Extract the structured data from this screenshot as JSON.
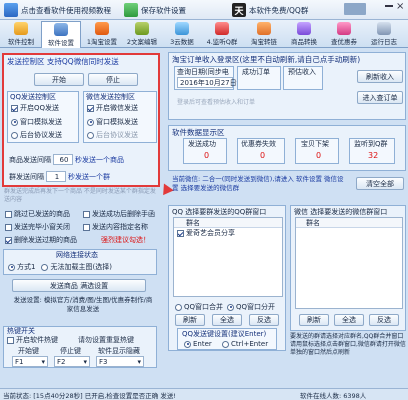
{
  "colors": {
    "accent": "#1a3aa0",
    "highlight_frame": "#e23a3a",
    "warning": "#dd1111"
  },
  "toolbar": {
    "tutorial_label": "点击查看软件使用视频教程",
    "save_label": "保存软件设置",
    "version_label": "本软件免费/QQ群"
  },
  "tabs": [
    {
      "label": "软件控制",
      "icon": "gamepad-icon"
    },
    {
      "label": "软件设置",
      "icon": "gear-icon"
    },
    {
      "label": "1淘宝设置",
      "icon": "taobao-icon"
    },
    {
      "label": "2文案编辑",
      "icon": "edit-icon"
    },
    {
      "label": "3云数据",
      "icon": "cloud-icon"
    },
    {
      "label": "4.监听Q群",
      "icon": "listen-icon"
    },
    {
      "label": "淘宝转链",
      "icon": "link-icon"
    },
    {
      "label": "商品转换",
      "icon": "convert-icon"
    },
    {
      "label": "查优惠券",
      "icon": "coupon-icon"
    },
    {
      "label": "运行日志",
      "icon": "log-icon"
    }
  ],
  "send_control": {
    "title": "发送控制区 支持QQ微信同时发送",
    "start_label": "开始",
    "stop_label": "停止",
    "qq_title": "QQ发送控制区",
    "qq_enable": "开启QQ发送",
    "qq_window": "窗口模拟发送",
    "qq_background": "后台协议发送",
    "wx_title": "微信发送控制区",
    "wx_enable": "开启微信发送",
    "wx_window": "窗口模拟发送",
    "wx_background": "后台协议发送",
    "product_interval_label": "商品发送间隔",
    "product_interval_value": "60",
    "product_interval_unit": "秒发送一个商品",
    "group_interval_label": "群发送间隔",
    "group_interval_value": "1",
    "group_interval_unit": "秒发送一个群",
    "note": "群发送完成后再发下一个商品 不是同时发送某个群指定发送内容"
  },
  "options": {
    "skip_sent": "跳过已发送的商品",
    "delete_after_send": "发送成功后删除手函",
    "close_chat_after": "发送完毕小窗关闭",
    "send_to_name": "发送内容指定名称",
    "delete_invalid": "删除发送过期的商品",
    "image_text_mode": "强烈建议勾选！"
  },
  "network": {
    "title": "网络连接状态",
    "mode_label": "方式1",
    "mode_desc": "无法加载主图(选择)",
    "send_product_label": "发送商品 满选设置",
    "filter_text": "发送设置: 模拟官方/消费/图/生图/优惠券制作/商家信息发送"
  },
  "hotkeys": {
    "title": "热键开关",
    "enable_label": "开启软件热键",
    "hint": "请勿设置重复热键",
    "start_label": "开始键",
    "stop_label": "停止键",
    "hide_label": "软件显示隐藏",
    "start_value": "F1",
    "stop_value": "F2",
    "hide_value": "F3"
  },
  "taobao_login": {
    "title": "淘宝订单收入登录区(这里不自动刷新,请自己点手动刷新)",
    "date_label": "查询日期(同步电脑)",
    "date_value": "2016年10月27日",
    "success_orders_label": "成功订单",
    "pending_income_label": "预估收入",
    "refresh_label": "刷新收入",
    "enter_orders_label": "进入查订单",
    "tip": "登录后可查看预估收入和订单"
  },
  "stats": {
    "title": "软件数据显示区",
    "items": [
      {
        "label": "发送成功",
        "value": "0"
      },
      {
        "label": "优惠券失效",
        "value": "0"
      },
      {
        "label": "宝贝下架",
        "value": "0"
      },
      {
        "label": "监听到Q群",
        "value": "32"
      }
    ]
  },
  "current_status": {
    "line": "当前微信: 二合一(同时发送到微信),请进入 软件设置 微信设置 选择要发送的微信群",
    "clear_label": "清空全部"
  },
  "qq_groups": {
    "title": "QQ 选择要群发送的QQ群窗口",
    "column": "群名",
    "rows": [
      "爱奇艺会员分享"
    ],
    "merge_label": "QQ窗口合并",
    "split_label": "QQ窗口分开",
    "refresh_label": "刷新",
    "select_all_label": "全选",
    "deselect_label": "反选",
    "send_key_title": "QQ发送键设置(建议Enter)",
    "enter_label": "Enter",
    "ctrl_enter_label": "Ctrl+Enter"
  },
  "wx_groups": {
    "title": "微信 选择要发送的微信群窗口",
    "column": "群名",
    "rows": [],
    "refresh_label": "刷新",
    "select_all_label": "全选",
    "deselect_label": "反选",
    "send_key_title": "微信发送键设置(建议Enter)",
    "enter_label": "Enter",
    "ctrl_enter_label": "Ctrl+Enter"
  },
  "help_text": "要发送的群请选择对应群名,QQ群合并窗口请用鼠标选择点击群窗口,微信群请打开微信单独的窗口然后点刷新",
  "status_bar": {
    "left": "当前状态: [15点40分28秒] 已开启,检查设置是否正确 发送!",
    "right": "软件在线人数: 6398人"
  }
}
